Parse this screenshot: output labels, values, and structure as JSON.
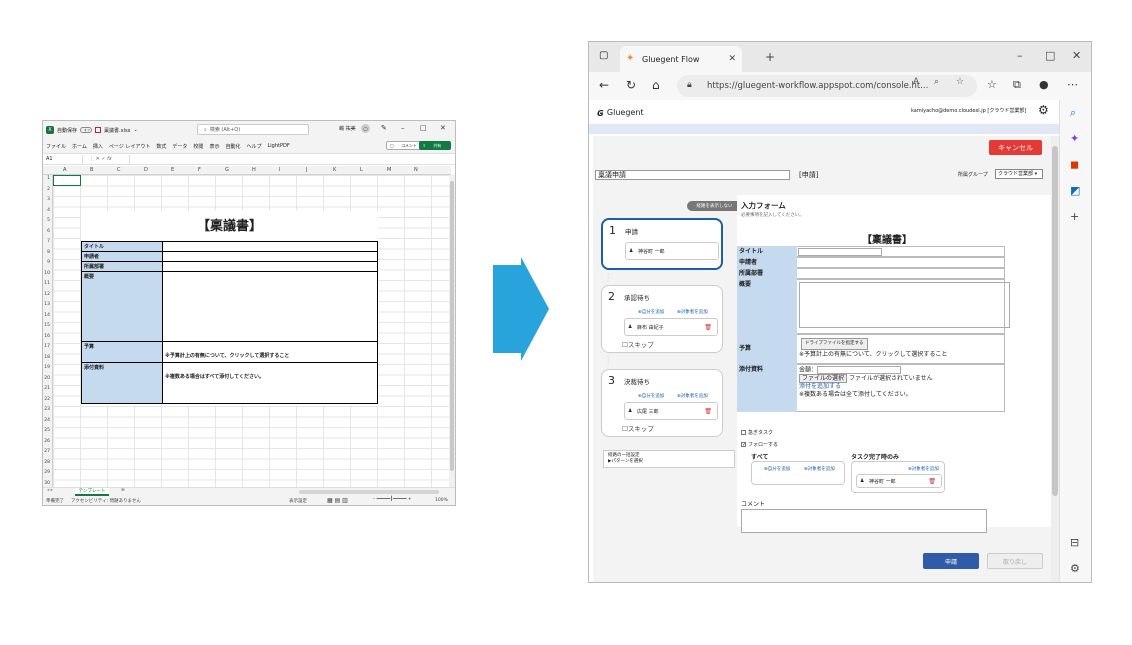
{
  "excel": {
    "autosave": "自動保存",
    "autosave_state": "オフ",
    "filename": "稟議書.xlsx",
    "search": "検索 (Alt+Q)",
    "user": "嶋 祐美",
    "menu": [
      "ファイル",
      "ホーム",
      "挿入",
      "ページ レイアウト",
      "数式",
      "データ",
      "校閲",
      "表示",
      "自動化",
      "ヘルプ",
      "LightPDF"
    ],
    "comment_btn": "コメント",
    "share_btn": "共有",
    "namebox": "A1",
    "fx": "fx",
    "columns": [
      "A",
      "B",
      "C",
      "D",
      "E",
      "F",
      "G",
      "H",
      "I",
      "J",
      "K",
      "L",
      "M",
      "N"
    ],
    "rows": [
      "1",
      "2",
      "3",
      "4",
      "5",
      "6",
      "7",
      "8",
      "9",
      "10",
      "11",
      "12",
      "13",
      "14",
      "15",
      "16",
      "17",
      "18",
      "19",
      "20",
      "21",
      "22",
      "23",
      "24",
      "25",
      "26",
      "27",
      "28",
      "29",
      "30"
    ],
    "doc_title": "【稟議書】",
    "table": {
      "title": "タイトル",
      "applicant": "申請者",
      "dept": "所属部署",
      "summary": "概要",
      "budget": "予算",
      "budget_note": "※予算計上の有無について、クリックして選択すること",
      "attachment": "添付資料",
      "attachment_note": "※複数ある場合はすべて添付してください。"
    },
    "sheet_tab": "テンプレート",
    "status_ready": "準備完了",
    "status_access": "アクセシビリティ: 問題ありません",
    "display_settings": "表示設定",
    "zoom": "100%"
  },
  "browser": {
    "tab_title": "Gluegent Flow",
    "url": "https://gluegent-workflow.appspot.com/console.ht...",
    "logo": "Gluegent",
    "user_email": "kamiyacho@demo.cloudexi.jp [クラウド営業部]",
    "cancel_btn": "キャンセル",
    "request_name": "稟議申請",
    "request_type": "[申請]",
    "group_label": "所属グループ",
    "group_value": "クラウド営業部",
    "route_toggle": "経路を表示しない",
    "steps": [
      {
        "num": "1",
        "title": "申請",
        "person": "神谷町 一郎"
      },
      {
        "num": "2",
        "title": "承認待ち",
        "opt_self": "自分を追加",
        "opt_target": "対象者を追加",
        "person": "麻布 由紀子",
        "skip": "スキップ"
      },
      {
        "num": "3",
        "title": "決裁待ち",
        "opt_self": "自分を追加",
        "opt_target": "対象者を追加",
        "person": "広尾 三郎",
        "skip": "スキップ"
      }
    ],
    "route_setting_1": "経路の一括設定",
    "route_setting_2": "▶パターンを選択",
    "form_title": "入力フォーム",
    "form_sub": "必要事項を記入してください。",
    "form_heading": "【稟議書】",
    "fields": {
      "title": "タイトル",
      "applicant": "申請者",
      "dept": "所属部署",
      "summary": "概要",
      "budget": "予算",
      "drive_btn": "ドライブファイルを指定する",
      "budget_note": "※予算計上の有無について、クリックして選択すること",
      "attachment": "添付資料",
      "amount": "金額：",
      "file_btn": "ファイルの選択",
      "file_none": "ファイルが選択されていません",
      "add_attach": "添付を追加する",
      "attach_note": "※複数ある場合は全て添付してください。"
    },
    "urgent": "急ぎタスク",
    "follow": "フォローする",
    "all_label": "すべて",
    "done_label": "タスク完了時のみ",
    "opt_self": "自分を追加",
    "opt_target": "対象者を追加",
    "done_person": "神谷町 一郎",
    "comment_label": "コメント",
    "submit_btn": "申請",
    "recall_btn": "取り戻し"
  },
  "colors": {
    "excel_green": "#107c41",
    "arrow": "#29a3dc",
    "cancel_red": "#e53935",
    "submit_blue": "#2e5ca8",
    "label_blue": "#c5d9ef"
  }
}
